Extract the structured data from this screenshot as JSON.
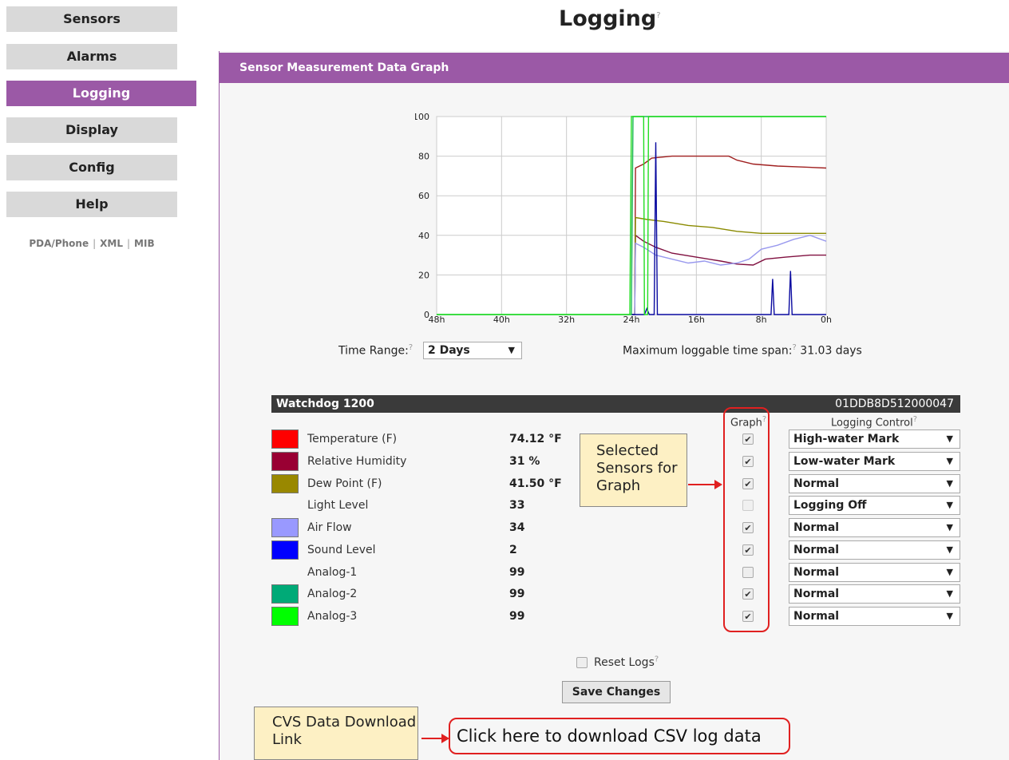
{
  "nav": {
    "items": [
      {
        "label": "Sensors"
      },
      {
        "label": "Alarms"
      },
      {
        "label": "Logging"
      },
      {
        "label": "Display"
      },
      {
        "label": "Config"
      },
      {
        "label": "Help"
      }
    ],
    "active": "Logging",
    "sub_links": [
      "PDA/Phone",
      "XML",
      "MIB"
    ],
    "accent_color": "#9b59a6"
  },
  "page": {
    "title": "Logging",
    "help_mark": "?"
  },
  "panel": {
    "header": "Sensor Measurement Data Graph"
  },
  "chart_data": {
    "type": "line",
    "x_ticks": [
      "48h",
      "40h",
      "32h",
      "24h",
      "16h",
      "8h",
      "0h"
    ],
    "y_ticks": [
      "0",
      "20",
      "40",
      "60",
      "80",
      "100"
    ],
    "ylim": [
      0,
      100
    ],
    "xlim_hours_ago": [
      48,
      0
    ],
    "grid": true,
    "series": [
      {
        "color": "#a02020",
        "points": [
          [
            24,
            0
          ],
          [
            23.6,
            0
          ],
          [
            23.5,
            74
          ],
          [
            22.5,
            76
          ],
          [
            21.5,
            79
          ],
          [
            19,
            80
          ],
          [
            15,
            80
          ],
          [
            12,
            80
          ],
          [
            11,
            78
          ],
          [
            9,
            76
          ],
          [
            6,
            75
          ],
          [
            3,
            74.5
          ],
          [
            0,
            74
          ]
        ]
      },
      {
        "color": "#801040",
        "points": [
          [
            24,
            0
          ],
          [
            23.6,
            0
          ],
          [
            23.5,
            40
          ],
          [
            22.5,
            37
          ],
          [
            21,
            34
          ],
          [
            19,
            31
          ],
          [
            16,
            29
          ],
          [
            13,
            27
          ],
          [
            11,
            25.5
          ],
          [
            9,
            25
          ],
          [
            7.5,
            28
          ],
          [
            5,
            29
          ],
          [
            2,
            30
          ],
          [
            0,
            30
          ]
        ]
      },
      {
        "color": "#8a8a00",
        "points": [
          [
            24,
            0
          ],
          [
            23.6,
            0
          ],
          [
            23.5,
            49
          ],
          [
            22,
            48
          ],
          [
            20,
            47
          ],
          [
            17,
            45
          ],
          [
            14,
            44
          ],
          [
            11,
            42
          ],
          [
            8,
            41
          ],
          [
            4,
            41
          ],
          [
            0,
            41
          ]
        ]
      },
      {
        "color": "#9999ee",
        "points": [
          [
            24,
            0
          ],
          [
            23.6,
            0
          ],
          [
            23.5,
            36
          ],
          [
            22.5,
            34
          ],
          [
            21,
            30
          ],
          [
            19,
            28
          ],
          [
            17,
            26
          ],
          [
            15,
            27
          ],
          [
            13,
            25
          ],
          [
            11,
            26
          ],
          [
            9.5,
            28
          ],
          [
            8,
            33
          ],
          [
            6,
            35
          ],
          [
            4,
            38
          ],
          [
            2,
            40
          ],
          [
            0,
            37
          ]
        ]
      },
      {
        "color": "#0a0aa0",
        "points": [
          [
            24,
            0
          ],
          [
            22.4,
            0
          ],
          [
            22.1,
            3
          ],
          [
            21.8,
            0
          ],
          [
            21.2,
            0
          ],
          [
            21.0,
            87
          ],
          [
            20.8,
            0
          ],
          [
            18,
            0
          ],
          [
            12,
            0
          ],
          [
            8,
            0
          ],
          [
            6.8,
            0
          ],
          [
            6.6,
            18
          ],
          [
            6.4,
            0
          ],
          [
            4.6,
            0
          ],
          [
            4.4,
            22
          ],
          [
            4.2,
            0
          ],
          [
            0,
            0
          ]
        ]
      },
      {
        "color": "#1db954",
        "points": [
          [
            48,
            0
          ],
          [
            24,
            0
          ],
          [
            23.8,
            100
          ],
          [
            0,
            100
          ]
        ]
      },
      {
        "color": "#22dd22",
        "points": [
          [
            48,
            0
          ],
          [
            24.2,
            0
          ],
          [
            24.0,
            100
          ],
          [
            22.5,
            100
          ],
          [
            22.4,
            0
          ],
          [
            22.0,
            0
          ],
          [
            21.9,
            100
          ],
          [
            0,
            100
          ]
        ]
      }
    ]
  },
  "time_range": {
    "label": "Time Range:",
    "value": "2 Days",
    "max_span_label": "Maximum loggable time span:",
    "max_span_value": "31.03 days"
  },
  "device": {
    "name": "Watchdog 1200",
    "serial": "01DDB8D512000047",
    "graph_header": "Graph",
    "logging_header": "Logging Control"
  },
  "sensors": [
    {
      "label": "Temperature (F)",
      "value": "74.12 °F",
      "color": "#ff0000",
      "graph": true,
      "control": "High-water Mark"
    },
    {
      "label": "Relative Humidity",
      "value": "31 %",
      "color": "#990033",
      "graph": true,
      "control": "Low-water Mark"
    },
    {
      "label": "Dew Point (F)",
      "value": "41.50 °F",
      "color": "#998800",
      "graph": true,
      "control": "Normal"
    },
    {
      "label": "Light Level",
      "value": "33",
      "color": "",
      "graph": false,
      "control": "Logging Off"
    },
    {
      "label": "Air Flow",
      "value": "34",
      "color": "#9999ff",
      "graph": true,
      "control": "Normal"
    },
    {
      "label": "Sound Level",
      "value": "2",
      "color": "#0000ff",
      "graph": true,
      "control": "Normal"
    },
    {
      "label": "Analog-1",
      "value": "99",
      "color": "",
      "graph": false,
      "control": "Normal"
    },
    {
      "label": "Analog-2",
      "value": "99",
      "color": "#00aa77",
      "graph": true,
      "control": "Normal"
    },
    {
      "label": "Analog-3",
      "value": "99",
      "color": "#00ff00",
      "graph": true,
      "control": "Normal"
    }
  ],
  "annotations": {
    "graph_callout": "Selected Sensors for Graph",
    "csv_callout": "CVS Data Download Link"
  },
  "actions": {
    "reset_logs": "Reset Logs",
    "save": "Save Changes",
    "download": "Click here to download CSV log data"
  }
}
